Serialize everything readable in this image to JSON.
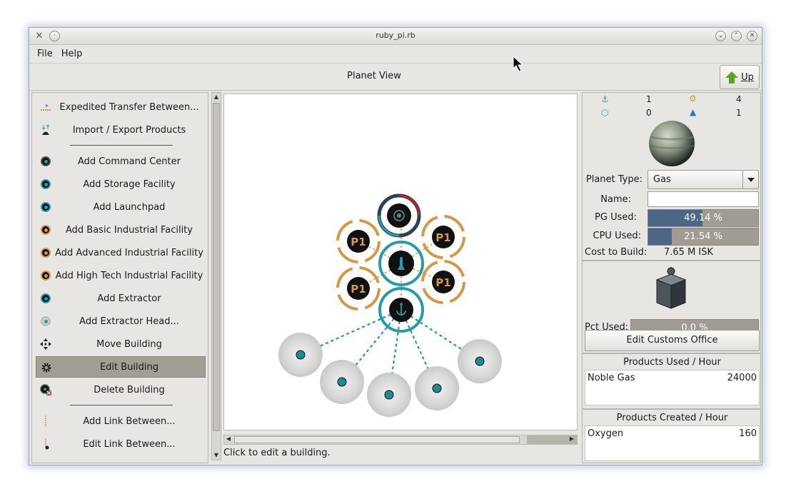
{
  "window": {
    "title": "ruby_pi.rb"
  },
  "menu": {
    "file": "File",
    "help": "Help"
  },
  "view": {
    "title": "Planet View",
    "up_label": "Up"
  },
  "tools": [
    {
      "label": "Expedited Transfer Between...",
      "icon": "transfer-icon"
    },
    {
      "label": "Import / Export Products",
      "icon": "import-export-icon"
    },
    {
      "label": "Add Command Center",
      "icon": "command-center-icon"
    },
    {
      "label": "Add Storage Facility",
      "icon": "storage-facility-icon"
    },
    {
      "label": "Add Launchpad",
      "icon": "launchpad-icon"
    },
    {
      "label": "Add Basic Industrial Facility",
      "icon": "basic-industry-icon"
    },
    {
      "label": "Add Advanced Industrial Facility",
      "icon": "advanced-industry-icon"
    },
    {
      "label": "Add High Tech Industrial Facility",
      "icon": "high-tech-industry-icon"
    },
    {
      "label": "Add Extractor",
      "icon": "extractor-icon"
    },
    {
      "label": "Add Extractor Head...",
      "icon": "extractor-head-icon"
    },
    {
      "label": "Move Building",
      "icon": "move-icon"
    },
    {
      "label": "Edit Building",
      "icon": "gear-icon",
      "selected": true
    },
    {
      "label": "Delete Building",
      "icon": "delete-icon"
    },
    {
      "label": "Add Link Between...",
      "icon": "link-icon"
    },
    {
      "label": "Edit Link Between...",
      "icon": "edit-link-icon"
    }
  ],
  "status": "Click to edit a building.",
  "stats": {
    "launchpads": "1",
    "factories": "4",
    "storage": "0",
    "extractors": "1"
  },
  "planet": {
    "type_label": "Planet Type:",
    "type_value": "Gas",
    "name_label": "Name:",
    "name_value": "",
    "pg_label": "PG Used:",
    "pg_value": "49.14 %",
    "pg_fraction": 0.4914,
    "cpu_label": "CPU Used:",
    "cpu_value": "21.54 %",
    "cpu_fraction": 0.2154,
    "cost_label": "Cost to Build:",
    "cost_value": "7.65 M ISK"
  },
  "customs": {
    "pct_label": "Pct Used:",
    "pct_value": "0.0 %",
    "pct_fraction": 0.0,
    "edit_button": "Edit Customs Office"
  },
  "products_used": {
    "title": "Products Used / Hour",
    "rows": [
      {
        "name": "Noble Gas",
        "value": "24000"
      }
    ]
  },
  "products_created": {
    "title": "Products Created / Hour",
    "rows": [
      {
        "name": "Oxygen",
        "value": "160"
      }
    ]
  },
  "factory_label": "P1",
  "colors": {
    "teal": "#2a9aa8",
    "orange": "#d4984a",
    "selection": "#a29d95",
    "bar_fill": "#4d6684"
  }
}
